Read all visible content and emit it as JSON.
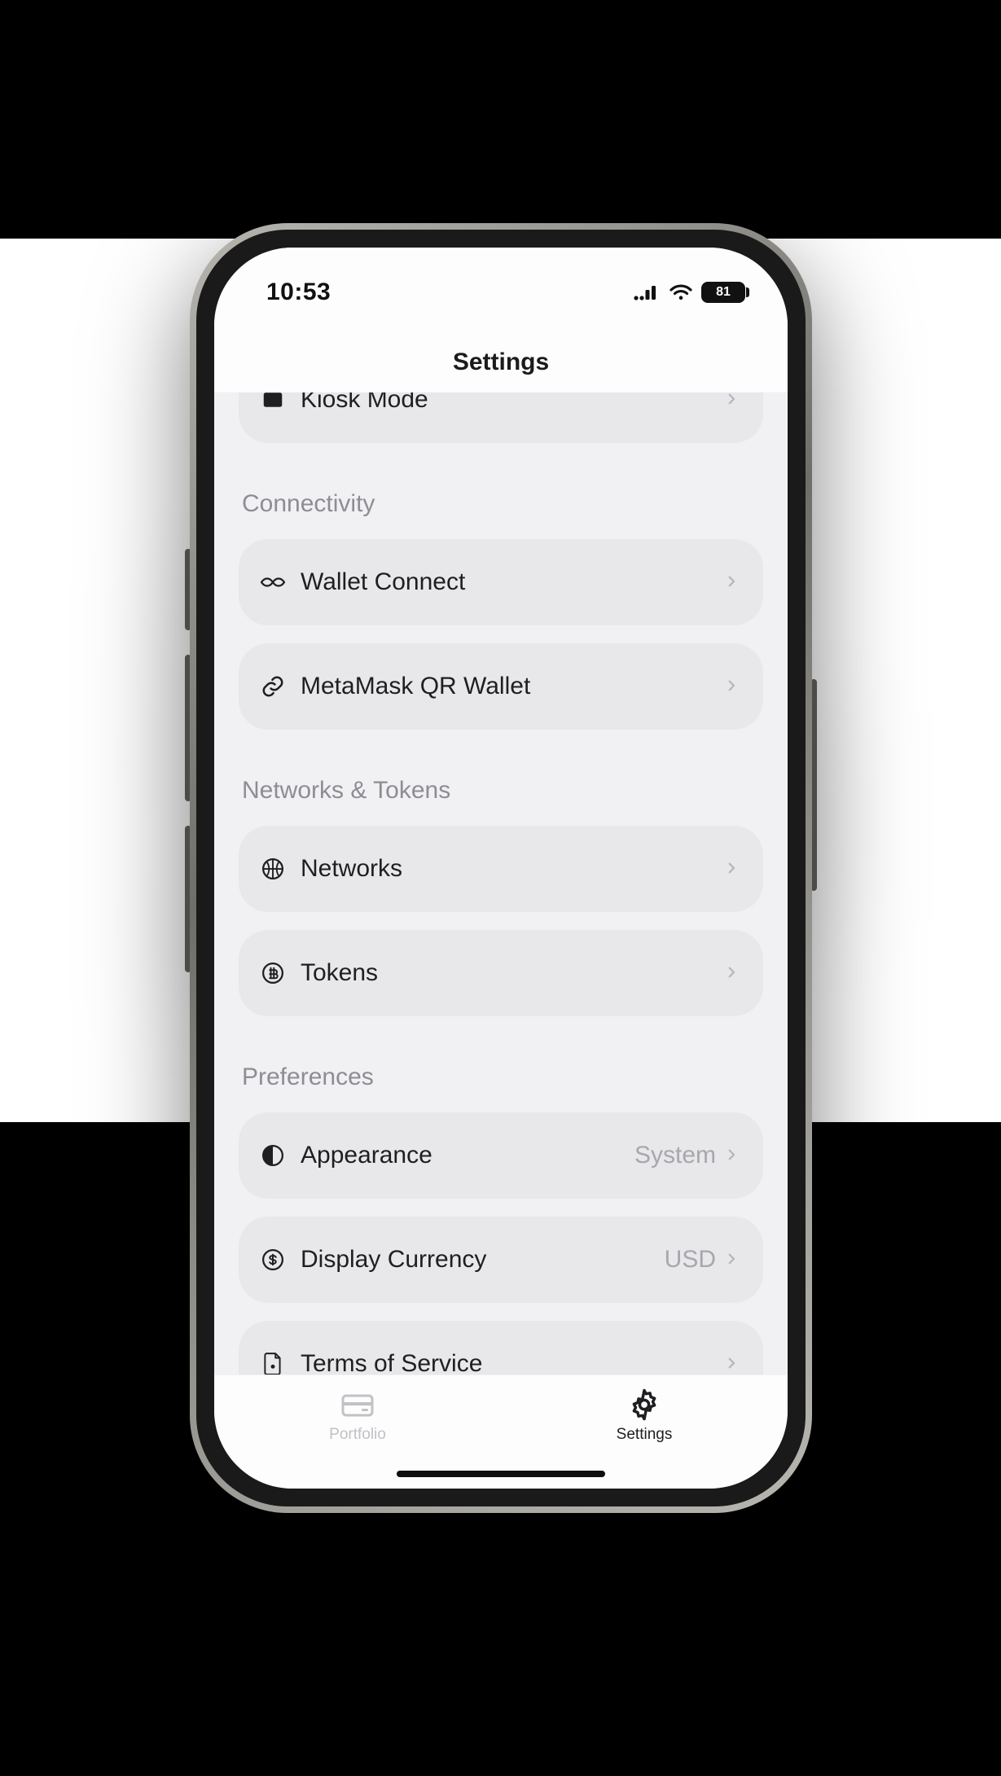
{
  "statusbar": {
    "time": "10:53",
    "battery": "81"
  },
  "header": {
    "title": "Settings"
  },
  "peek_row": {
    "label": "Kiosk Mode"
  },
  "sections": {
    "connectivity": {
      "title": "Connectivity",
      "wallet_connect": "Wallet Connect",
      "metamask_qr": "MetaMask QR Wallet"
    },
    "networks_tokens": {
      "title": "Networks & Tokens",
      "networks": "Networks",
      "tokens": "Tokens"
    },
    "preferences": {
      "title": "Preferences",
      "appearance": {
        "label": "Appearance",
        "value": "System"
      },
      "currency": {
        "label": "Display Currency",
        "value": "USD"
      },
      "tos": "Terms of Service"
    }
  },
  "tabs": {
    "portfolio": "Portfolio",
    "settings": "Settings"
  }
}
